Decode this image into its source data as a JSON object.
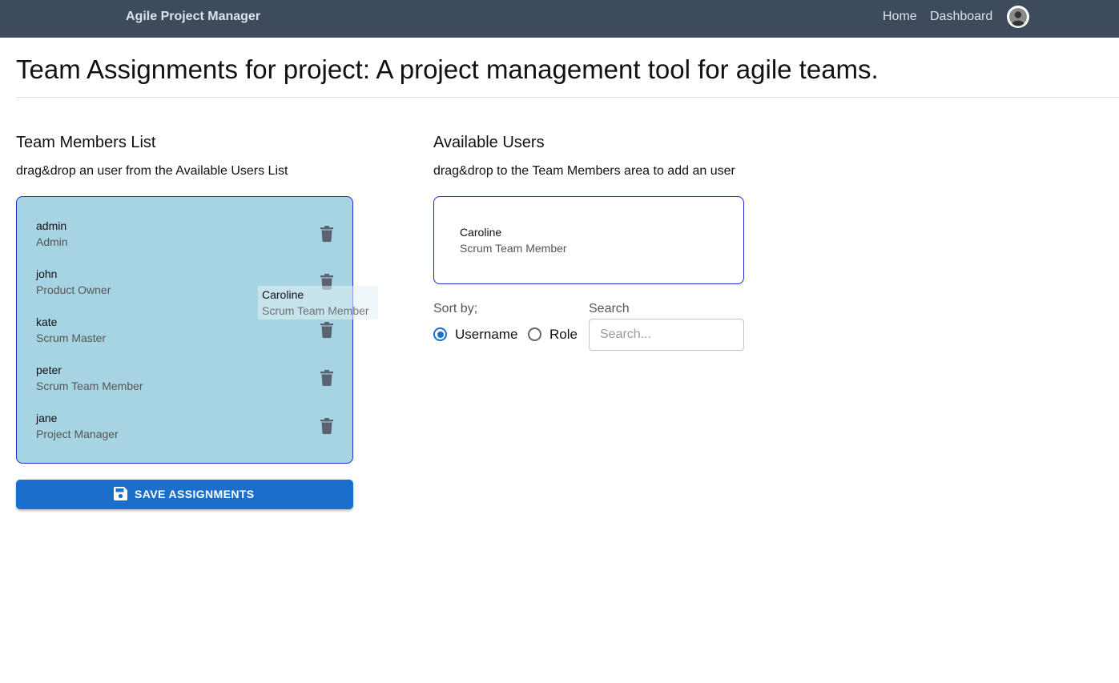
{
  "navbar": {
    "brand": "Agile Project Manager",
    "links": [
      "Home",
      "Dashboard"
    ]
  },
  "page": {
    "title": "Team Assignments for project: A project management tool for agile teams."
  },
  "team": {
    "title": "Team Members List",
    "hint": "drag&drop an user from the Available Users List",
    "members": [
      {
        "name": "admin",
        "role": "Admin"
      },
      {
        "name": "john",
        "role": "Product Owner"
      },
      {
        "name": "kate",
        "role": "Scrum Master"
      },
      {
        "name": "peter",
        "role": "Scrum Team Member"
      },
      {
        "name": "jane",
        "role": "Project Manager"
      }
    ],
    "save_label": "SAVE ASSIGNMENTS"
  },
  "drag_ghost": {
    "name": "Caroline",
    "role": "Scrum Team Member"
  },
  "available": {
    "title": "Available Users",
    "hint": "drag&drop to the Team Members area to add an user",
    "users": [
      {
        "name": "Caroline",
        "role": "Scrum Team Member"
      }
    ]
  },
  "sort": {
    "label": "Sort by;",
    "options": [
      "Username",
      "Role"
    ],
    "selected": "Username"
  },
  "search": {
    "label": "Search",
    "placeholder": "Search...",
    "value": ""
  },
  "colors": {
    "navbar": "#3d4b5c",
    "team_box": "#a7d4e3",
    "box_border": "#1f2ccf",
    "primary": "#1a6fcc"
  },
  "icons": [
    "user-avatar-icon",
    "trash-icon",
    "save-icon"
  ]
}
